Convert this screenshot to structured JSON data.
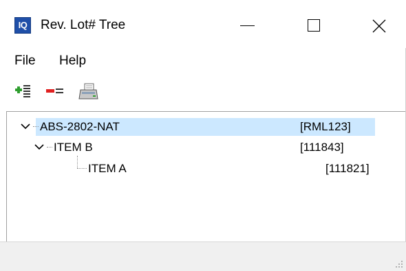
{
  "window": {
    "title": "Rev. Lot# Tree",
    "app_icon_text": "IQ",
    "controls": [
      "minimize",
      "maximize",
      "close"
    ]
  },
  "menu": {
    "file": "File",
    "help": "Help"
  },
  "toolbar": {
    "buttons": [
      {
        "icon": "add-node-icon"
      },
      {
        "icon": "remove-node-icon"
      },
      {
        "icon": "print-icon"
      }
    ]
  },
  "tree": {
    "nodes": [
      {
        "label": "ABS-2802-NAT",
        "code": "[RML123]",
        "level": 0,
        "expanded": true,
        "selected": true
      },
      {
        "label": "ITEM B",
        "code": "[111843]",
        "level": 1,
        "expanded": true,
        "selected": false
      },
      {
        "label": "ITEM A",
        "code": "[111821]",
        "level": 2,
        "expanded": false,
        "selected": false
      }
    ]
  },
  "colors": {
    "selection": "#cce8ff",
    "statusbar": "#f0f0f0",
    "app_icon": "#1f4fa8"
  }
}
